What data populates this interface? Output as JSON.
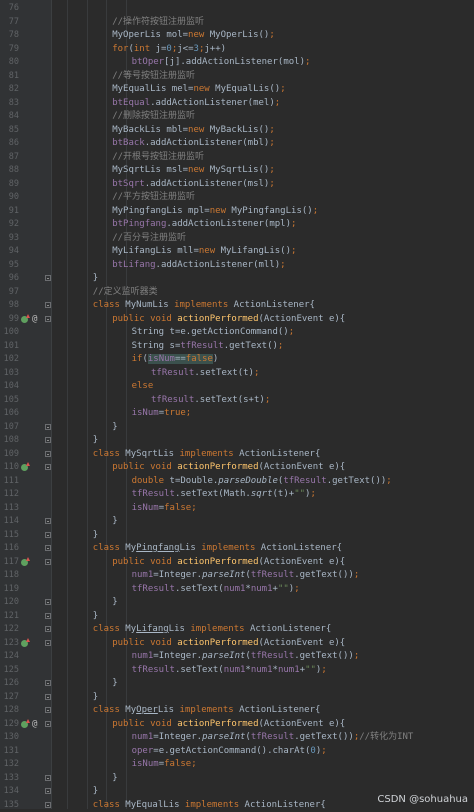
{
  "colors": {
    "background": "#2b2b2b",
    "gutter": "#313335",
    "line_number": "#606366",
    "default": "#a9b7c6",
    "keyword": "#cc7832",
    "field": "#9876aa",
    "comment": "#808080",
    "number": "#6897bb",
    "string": "#6a8759",
    "method": "#ffc66d",
    "implements_marker": "#5fa05f",
    "highlight": "#3b514d"
  },
  "watermark": "CSDN @sohuahua",
  "lines": [
    {
      "n": "76",
      "ind": 0,
      "fold": false,
      "mark": "",
      "tokens": []
    },
    {
      "n": "77",
      "ind": 3,
      "fold": false,
      "mark": "",
      "tokens": [
        {
          "t": "//操作符按钮注册监听",
          "c": "cm"
        }
      ]
    },
    {
      "n": "78",
      "ind": 3,
      "fold": false,
      "mark": "",
      "tokens": [
        {
          "t": "MyOperLis mol="
        },
        {
          "t": "new",
          "c": "kw"
        },
        {
          "t": " MyOperLis()"
        },
        {
          "t": ";",
          "c": "kw"
        }
      ]
    },
    {
      "n": "79",
      "ind": 3,
      "fold": false,
      "mark": "",
      "tokens": [
        {
          "t": "for",
          "c": "kw"
        },
        {
          "t": "("
        },
        {
          "t": "int",
          "c": "kw"
        },
        {
          "t": " j="
        },
        {
          "t": "0",
          "c": "num"
        },
        {
          "t": ";",
          "c": "kw"
        },
        {
          "t": "j<="
        },
        {
          "t": "3",
          "c": "num"
        },
        {
          "t": ";",
          "c": "kw"
        },
        {
          "t": "j++)"
        }
      ]
    },
    {
      "n": "80",
      "ind": 4,
      "fold": false,
      "mark": "",
      "tokens": [
        {
          "t": "btOper",
          "c": "fld"
        },
        {
          "t": "[j].addActionListener(mol)"
        },
        {
          "t": ";",
          "c": "kw"
        }
      ]
    },
    {
      "n": "81",
      "ind": 3,
      "fold": false,
      "mark": "",
      "tokens": [
        {
          "t": "//等号按钮注册监听",
          "c": "cm"
        }
      ]
    },
    {
      "n": "82",
      "ind": 3,
      "fold": false,
      "mark": "",
      "tokens": [
        {
          "t": "MyEqualLis mel="
        },
        {
          "t": "new",
          "c": "kw"
        },
        {
          "t": " MyEqualLis()"
        },
        {
          "t": ";",
          "c": "kw"
        }
      ]
    },
    {
      "n": "83",
      "ind": 3,
      "fold": false,
      "mark": "",
      "tokens": [
        {
          "t": "btEqual",
          "c": "fld"
        },
        {
          "t": ".addActionListener(mel)"
        },
        {
          "t": ";",
          "c": "kw"
        }
      ]
    },
    {
      "n": "84",
      "ind": 3,
      "fold": false,
      "mark": "",
      "tokens": [
        {
          "t": "//删除按钮注册监听",
          "c": "cm"
        }
      ]
    },
    {
      "n": "85",
      "ind": 3,
      "fold": false,
      "mark": "",
      "tokens": [
        {
          "t": "MyBackLis mbl="
        },
        {
          "t": "new",
          "c": "kw"
        },
        {
          "t": " MyBackLis()"
        },
        {
          "t": ";",
          "c": "kw"
        }
      ]
    },
    {
      "n": "86",
      "ind": 3,
      "fold": false,
      "mark": "",
      "tokens": [
        {
          "t": "btBack",
          "c": "fld"
        },
        {
          "t": ".addActionListener(mbl)"
        },
        {
          "t": ";",
          "c": "kw"
        }
      ]
    },
    {
      "n": "87",
      "ind": 3,
      "fold": false,
      "mark": "",
      "tokens": [
        {
          "t": "//开根号按钮注册监听",
          "c": "cm"
        }
      ]
    },
    {
      "n": "88",
      "ind": 3,
      "fold": false,
      "mark": "",
      "tokens": [
        {
          "t": "MySqrtLis msl="
        },
        {
          "t": "new",
          "c": "kw"
        },
        {
          "t": " MySqrtLis()"
        },
        {
          "t": ";",
          "c": "kw"
        }
      ]
    },
    {
      "n": "89",
      "ind": 3,
      "fold": false,
      "mark": "",
      "tokens": [
        {
          "t": "btSqrt",
          "c": "fld"
        },
        {
          "t": ".addActionListener(msl)"
        },
        {
          "t": ";",
          "c": "kw"
        }
      ]
    },
    {
      "n": "90",
      "ind": 3,
      "fold": false,
      "mark": "",
      "tokens": [
        {
          "t": "//平方按钮注册监听",
          "c": "cm"
        }
      ]
    },
    {
      "n": "91",
      "ind": 3,
      "fold": false,
      "mark": "",
      "tokens": [
        {
          "t": "MyPingfangLis mpl="
        },
        {
          "t": "new",
          "c": "kw"
        },
        {
          "t": " MyPingfangLis()"
        },
        {
          "t": ";",
          "c": "kw"
        }
      ]
    },
    {
      "n": "92",
      "ind": 3,
      "fold": false,
      "mark": "",
      "tokens": [
        {
          "t": "btPingfang",
          "c": "fld"
        },
        {
          "t": ".addActionListener(mpl)"
        },
        {
          "t": ";",
          "c": "kw"
        }
      ]
    },
    {
      "n": "93",
      "ind": 3,
      "fold": false,
      "mark": "",
      "tokens": [
        {
          "t": "//百分号注册监听",
          "c": "cm"
        }
      ]
    },
    {
      "n": "94",
      "ind": 3,
      "fold": false,
      "mark": "",
      "tokens": [
        {
          "t": "MyLifangLis mll="
        },
        {
          "t": "new",
          "c": "kw"
        },
        {
          "t": " MyLifangLis()"
        },
        {
          "t": ";",
          "c": "kw"
        }
      ]
    },
    {
      "n": "95",
      "ind": 3,
      "fold": false,
      "mark": "",
      "tokens": [
        {
          "t": "btLifang",
          "c": "fld"
        },
        {
          "t": ".addActionListener(mll)"
        },
        {
          "t": ";",
          "c": "kw"
        }
      ]
    },
    {
      "n": "96",
      "ind": 2,
      "fold": true,
      "mark": "",
      "tokens": [
        {
          "t": "}"
        }
      ]
    },
    {
      "n": "97",
      "ind": 2,
      "fold": false,
      "mark": "",
      "tokens": [
        {
          "t": "//定义监听器类",
          "c": "cm"
        }
      ]
    },
    {
      "n": "98",
      "ind": 2,
      "fold": true,
      "mark": "",
      "tokens": [
        {
          "t": "class",
          "c": "kw"
        },
        {
          "t": " MyNumLis "
        },
        {
          "t": "implements",
          "c": "kw"
        },
        {
          "t": " ActionListener{"
        }
      ]
    },
    {
      "n": "99",
      "ind": 3,
      "fold": true,
      "mark": "impl-at",
      "tokens": [
        {
          "t": "public",
          "c": "kw"
        },
        {
          "t": " "
        },
        {
          "t": "void",
          "c": "kw"
        },
        {
          "t": " "
        },
        {
          "t": "actionPerformed",
          "c": "fn"
        },
        {
          "t": "(ActionEvent e){"
        }
      ]
    },
    {
      "n": "100",
      "ind": 4,
      "fold": false,
      "mark": "",
      "tokens": [
        {
          "t": "String t=e.getActionCommand()"
        },
        {
          "t": ";",
          "c": "kw"
        }
      ]
    },
    {
      "n": "101",
      "ind": 4,
      "fold": false,
      "mark": "",
      "tokens": [
        {
          "t": "String s="
        },
        {
          "t": "tfResult",
          "c": "fld"
        },
        {
          "t": ".getText()"
        },
        {
          "t": ";",
          "c": "kw"
        }
      ]
    },
    {
      "n": "102",
      "ind": 4,
      "fold": false,
      "mark": "",
      "tokens": [
        {
          "t": "if",
          "c": "kw"
        },
        {
          "t": "("
        },
        {
          "t": "isNum",
          "c": "fld hl"
        },
        {
          "t": "==",
          "c": "hl"
        },
        {
          "t": "false",
          "c": "kw hl"
        },
        {
          "t": ")"
        }
      ]
    },
    {
      "n": "103",
      "ind": 5,
      "fold": false,
      "mark": "",
      "tokens": [
        {
          "t": "tfResult",
          "c": "fld"
        },
        {
          "t": ".setText(t)"
        },
        {
          "t": ";",
          "c": "kw"
        }
      ]
    },
    {
      "n": "104",
      "ind": 4,
      "fold": false,
      "mark": "",
      "tokens": [
        {
          "t": "else",
          "c": "kw"
        }
      ]
    },
    {
      "n": "105",
      "ind": 5,
      "fold": false,
      "mark": "",
      "tokens": [
        {
          "t": "tfResult",
          "c": "fld"
        },
        {
          "t": ".setText(s+t)"
        },
        {
          "t": ";",
          "c": "kw"
        }
      ]
    },
    {
      "n": "106",
      "ind": 4,
      "fold": false,
      "mark": "",
      "tokens": [
        {
          "t": "isNum",
          "c": "fld"
        },
        {
          "t": "="
        },
        {
          "t": "true",
          "c": "kw"
        },
        {
          "t": ";",
          "c": "kw"
        }
      ]
    },
    {
      "n": "107",
      "ind": 3,
      "fold": true,
      "mark": "",
      "tokens": [
        {
          "t": "}"
        }
      ]
    },
    {
      "n": "108",
      "ind": 2,
      "fold": true,
      "mark": "",
      "tokens": [
        {
          "t": "}"
        }
      ]
    },
    {
      "n": "109",
      "ind": 2,
      "fold": true,
      "mark": "",
      "tokens": [
        {
          "t": "class",
          "c": "kw"
        },
        {
          "t": " MySqrtLis "
        },
        {
          "t": "implements",
          "c": "kw"
        },
        {
          "t": " ActionListener{"
        }
      ]
    },
    {
      "n": "110",
      "ind": 3,
      "fold": true,
      "mark": "impl",
      "tokens": [
        {
          "t": "public",
          "c": "kw"
        },
        {
          "t": " "
        },
        {
          "t": "void",
          "c": "kw"
        },
        {
          "t": " "
        },
        {
          "t": "actionPerformed",
          "c": "fn"
        },
        {
          "t": "(ActionEvent e){"
        }
      ]
    },
    {
      "n": "111",
      "ind": 4,
      "fold": false,
      "mark": "",
      "tokens": [
        {
          "t": "double",
          "c": "kw"
        },
        {
          "t": " t=Double."
        },
        {
          "t": "parseDouble",
          "c": "it"
        },
        {
          "t": "("
        },
        {
          "t": "tfResult",
          "c": "fld"
        },
        {
          "t": ".getText())"
        },
        {
          "t": ";",
          "c": "kw"
        }
      ]
    },
    {
      "n": "112",
      "ind": 4,
      "fold": false,
      "mark": "",
      "tokens": [
        {
          "t": "tfResult",
          "c": "fld"
        },
        {
          "t": ".setText(Math."
        },
        {
          "t": "sqrt",
          "c": "it"
        },
        {
          "t": "(t)+"
        },
        {
          "t": "\"\"",
          "c": "str"
        },
        {
          "t": ")"
        },
        {
          "t": ";",
          "c": "kw"
        }
      ]
    },
    {
      "n": "113",
      "ind": 4,
      "fold": false,
      "mark": "",
      "tokens": [
        {
          "t": "isNum",
          "c": "fld"
        },
        {
          "t": "="
        },
        {
          "t": "false",
          "c": "kw"
        },
        {
          "t": ";",
          "c": "kw"
        }
      ]
    },
    {
      "n": "114",
      "ind": 3,
      "fold": true,
      "mark": "",
      "tokens": [
        {
          "t": "}"
        }
      ]
    },
    {
      "n": "115",
      "ind": 2,
      "fold": true,
      "mark": "",
      "tokens": [
        {
          "t": "}"
        }
      ]
    },
    {
      "n": "116",
      "ind": 2,
      "fold": true,
      "mark": "",
      "tokens": [
        {
          "t": "class",
          "c": "kw"
        },
        {
          "t": " My"
        },
        {
          "t": "Pingfang",
          "c": "ul"
        },
        {
          "t": "Lis "
        },
        {
          "t": "implements",
          "c": "kw"
        },
        {
          "t": " ActionListener{"
        }
      ]
    },
    {
      "n": "117",
      "ind": 3,
      "fold": true,
      "mark": "impl",
      "tokens": [
        {
          "t": "public",
          "c": "kw"
        },
        {
          "t": " "
        },
        {
          "t": "void",
          "c": "kw"
        },
        {
          "t": " "
        },
        {
          "t": "actionPerformed",
          "c": "fn"
        },
        {
          "t": "(ActionEvent e){"
        }
      ]
    },
    {
      "n": "118",
      "ind": 4,
      "fold": false,
      "mark": "",
      "tokens": [
        {
          "t": "num1",
          "c": "fld"
        },
        {
          "t": "=Integer."
        },
        {
          "t": "parseInt",
          "c": "it"
        },
        {
          "t": "("
        },
        {
          "t": "tfResult",
          "c": "fld"
        },
        {
          "t": ".getText())"
        },
        {
          "t": ";",
          "c": "kw"
        }
      ]
    },
    {
      "n": "119",
      "ind": 4,
      "fold": false,
      "mark": "",
      "tokens": [
        {
          "t": "tfResult",
          "c": "fld"
        },
        {
          "t": ".setText("
        },
        {
          "t": "num1",
          "c": "fld"
        },
        {
          "t": "*"
        },
        {
          "t": "num1",
          "c": "fld"
        },
        {
          "t": "+"
        },
        {
          "t": "\"\"",
          "c": "str"
        },
        {
          "t": ")"
        },
        {
          "t": ";",
          "c": "kw"
        }
      ]
    },
    {
      "n": "120",
      "ind": 3,
      "fold": true,
      "mark": "",
      "tokens": [
        {
          "t": "}"
        }
      ]
    },
    {
      "n": "121",
      "ind": 2,
      "fold": true,
      "mark": "",
      "tokens": [
        {
          "t": "}"
        }
      ]
    },
    {
      "n": "122",
      "ind": 2,
      "fold": true,
      "mark": "",
      "tokens": [
        {
          "t": "class",
          "c": "kw"
        },
        {
          "t": " My"
        },
        {
          "t": "Lifang",
          "c": "ul"
        },
        {
          "t": "Lis "
        },
        {
          "t": "implements",
          "c": "kw"
        },
        {
          "t": " ActionListener{"
        }
      ]
    },
    {
      "n": "123",
      "ind": 3,
      "fold": true,
      "mark": "impl",
      "tokens": [
        {
          "t": "public",
          "c": "kw"
        },
        {
          "t": " "
        },
        {
          "t": "void",
          "c": "kw"
        },
        {
          "t": " "
        },
        {
          "t": "actionPerformed",
          "c": "fn"
        },
        {
          "t": "(ActionEvent e){"
        }
      ]
    },
    {
      "n": "124",
      "ind": 4,
      "fold": false,
      "mark": "",
      "tokens": [
        {
          "t": "num1",
          "c": "fld"
        },
        {
          "t": "=Integer."
        },
        {
          "t": "parseInt",
          "c": "it"
        },
        {
          "t": "("
        },
        {
          "t": "tfResult",
          "c": "fld"
        },
        {
          "t": ".getText())"
        },
        {
          "t": ";",
          "c": "kw"
        }
      ]
    },
    {
      "n": "125",
      "ind": 4,
      "fold": false,
      "mark": "",
      "tokens": [
        {
          "t": "tfResult",
          "c": "fld"
        },
        {
          "t": ".setText("
        },
        {
          "t": "num1",
          "c": "fld"
        },
        {
          "t": "*"
        },
        {
          "t": "num1",
          "c": "fld"
        },
        {
          "t": "*"
        },
        {
          "t": "num1",
          "c": "fld"
        },
        {
          "t": "+"
        },
        {
          "t": "\"\"",
          "c": "str"
        },
        {
          "t": ")"
        },
        {
          "t": ";",
          "c": "kw"
        }
      ]
    },
    {
      "n": "126",
      "ind": 3,
      "fold": true,
      "mark": "",
      "tokens": [
        {
          "t": "}"
        }
      ]
    },
    {
      "n": "127",
      "ind": 2,
      "fold": true,
      "mark": "",
      "tokens": [
        {
          "t": "}"
        }
      ]
    },
    {
      "n": "128",
      "ind": 2,
      "fold": true,
      "mark": "",
      "tokens": [
        {
          "t": "class",
          "c": "kw"
        },
        {
          "t": " My"
        },
        {
          "t": "Oper",
          "c": "ul"
        },
        {
          "t": "Lis "
        },
        {
          "t": "implements",
          "c": "kw"
        },
        {
          "t": " ActionListener{"
        }
      ]
    },
    {
      "n": "129",
      "ind": 3,
      "fold": true,
      "mark": "impl-at",
      "tokens": [
        {
          "t": "public",
          "c": "kw"
        },
        {
          "t": " "
        },
        {
          "t": "void",
          "c": "kw"
        },
        {
          "t": " "
        },
        {
          "t": "actionPerformed",
          "c": "fn"
        },
        {
          "t": "(ActionEvent e){"
        }
      ]
    },
    {
      "n": "130",
      "ind": 4,
      "fold": false,
      "mark": "",
      "tokens": [
        {
          "t": "num1",
          "c": "fld"
        },
        {
          "t": "=Integer."
        },
        {
          "t": "parseInt",
          "c": "it"
        },
        {
          "t": "("
        },
        {
          "t": "tfResult",
          "c": "fld"
        },
        {
          "t": ".getText())"
        },
        {
          "t": ";",
          "c": "kw"
        },
        {
          "t": "//转化为INT",
          "c": "cm"
        }
      ]
    },
    {
      "n": "131",
      "ind": 4,
      "fold": false,
      "mark": "",
      "tokens": [
        {
          "t": "oper",
          "c": "fld"
        },
        {
          "t": "=e.getActionCommand().charAt("
        },
        {
          "t": "0",
          "c": "num"
        },
        {
          "t": ")"
        },
        {
          "t": ";",
          "c": "kw"
        }
      ]
    },
    {
      "n": "132",
      "ind": 4,
      "fold": false,
      "mark": "",
      "tokens": [
        {
          "t": "isNum",
          "c": "fld"
        },
        {
          "t": "="
        },
        {
          "t": "false",
          "c": "kw"
        },
        {
          "t": ";",
          "c": "kw"
        }
      ]
    },
    {
      "n": "133",
      "ind": 3,
      "fold": true,
      "mark": "",
      "tokens": [
        {
          "t": "}"
        }
      ]
    },
    {
      "n": "134",
      "ind": 2,
      "fold": true,
      "mark": "",
      "tokens": [
        {
          "t": "}"
        }
      ]
    },
    {
      "n": "135",
      "ind": 2,
      "fold": true,
      "mark": "",
      "tokens": [
        {
          "t": "class",
          "c": "kw"
        },
        {
          "t": " MyEqualLis "
        },
        {
          "t": "implements",
          "c": "kw"
        },
        {
          "t": " ActionListener{"
        }
      ]
    }
  ]
}
